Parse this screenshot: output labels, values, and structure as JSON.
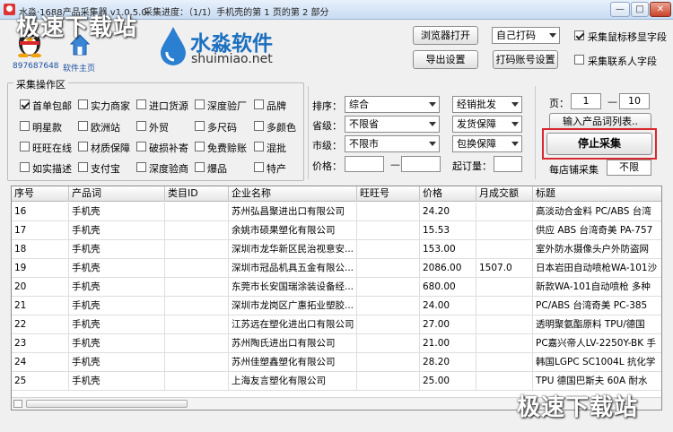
{
  "window": {
    "title": "水淼·1688产品采集器 v1.0.5.0",
    "progress": "采集进度：（1/1）手机壳的第 1 页的第 2 部分",
    "min": "—",
    "max": "□",
    "close": "✕"
  },
  "watermark": "极速下载站",
  "header": {
    "qq_number": "897687648",
    "home_link": "软件主页",
    "logo_cn": "水淼软件",
    "logo_en": "shuimiao.net",
    "browser_button": "浏览器打开",
    "print_select": "自己打码",
    "export_button": "导出设置",
    "print_settings_button": "打码账号设置",
    "cb_mark_fields": {
      "label": "采集鼠标移显字段",
      "checked": true
    },
    "cb_contact_fields": {
      "label": "采集联系人字段",
      "checked": false
    }
  },
  "filters": {
    "title": "采集操作区",
    "checkboxes": [
      {
        "label": "首单包邮",
        "checked": true
      },
      {
        "label": "实力商家",
        "checked": false
      },
      {
        "label": "进口货源",
        "checked": false
      },
      {
        "label": "深度验厂",
        "checked": false
      },
      {
        "label": "品牌",
        "checked": false
      },
      {
        "label": "明星款",
        "checked": false
      },
      {
        "label": "欧洲站",
        "checked": false
      },
      {
        "label": "外贸",
        "checked": false
      },
      {
        "label": "多尺码",
        "checked": false
      },
      {
        "label": "多颜色",
        "checked": false
      },
      {
        "label": "旺旺在线",
        "checked": false
      },
      {
        "label": "材质保障",
        "checked": false
      },
      {
        "label": "破损补寄",
        "checked": false
      },
      {
        "label": "免费赊账",
        "checked": false
      },
      {
        "label": "混批",
        "checked": false
      },
      {
        "label": "如实描述",
        "checked": false
      },
      {
        "label": "支付宝",
        "checked": false
      },
      {
        "label": "深度验商",
        "checked": false
      },
      {
        "label": "爆品",
        "checked": false
      },
      {
        "label": "特产",
        "checked": false
      }
    ]
  },
  "search": {
    "sort_label": "排序：",
    "sort_value": "综合",
    "province_label": "省级：",
    "province_value": "不限省",
    "city_label": "市级：",
    "city_value": "不限市",
    "price_label": "价格：",
    "price_min": "",
    "price_sep": "—",
    "price_max": "",
    "sell_mode": "经销批发",
    "ship_guarantee": "发货保障",
    "exchange_guarantee": "包换保障",
    "min_order_label": "起订量：",
    "min_order_value": ""
  },
  "collect": {
    "page_label": "页：",
    "page_from": "1",
    "page_sep": "—",
    "page_to": "10",
    "import_button": "输入产品词列表..",
    "stop_button": "停止采集",
    "per_shop_label": "每店铺采集",
    "per_shop_value": "不限"
  },
  "table": {
    "columns": [
      "序号",
      "产品词",
      "类目ID",
      "企业名称",
      "旺旺号",
      "价格",
      "月成交额",
      "标题"
    ],
    "rows": [
      [
        "16",
        "手机壳",
        "",
        "苏州弘昌聚进出口有限公司",
        "",
        "24.20",
        "",
        "高淡动合金料 PC/ABS 台湾"
      ],
      [
        "17",
        "手机壳",
        "",
        "余姚市硕果塑化有限公司",
        "",
        "15.53",
        "",
        "供应 ABS 台湾奇美 PA-757"
      ],
      [
        "18",
        "手机壳",
        "",
        "深圳市龙华新区民治视意安...",
        "",
        "153.00",
        "",
        "室外防水摄像头户外防盗网"
      ],
      [
        "19",
        "手机壳",
        "",
        "深圳市冠品机具五金有限公...",
        "",
        "2086.00",
        "1507.0",
        "日本岩田自动喷枪WA-101沙"
      ],
      [
        "20",
        "手机壳",
        "",
        "东莞市长安国瑞涂装设备经...",
        "",
        "680.00",
        "",
        "新款WA-101自动喷枪 多种"
      ],
      [
        "21",
        "手机壳",
        "",
        "深圳市龙岗区广惠拓业塑胶...",
        "",
        "24.00",
        "",
        "PC/ABS 台湾奇美 PC-385"
      ],
      [
        "22",
        "手机壳",
        "",
        "江苏远在塑化进出口有限公司",
        "",
        "27.00",
        "",
        "透明聚氨酯原料 TPU/德国"
      ],
      [
        "23",
        "手机壳",
        "",
        "苏州陶氏进出口有限公司",
        "",
        "21.00",
        "",
        "PC嘉兴帝人LV-2250Y-BK 手"
      ],
      [
        "24",
        "手机壳",
        "",
        "苏州佳塑鑫塑化有限公司",
        "",
        "28.20",
        "",
        "韩国LGPC SC1004L 抗化学"
      ],
      [
        "25",
        "手机壳",
        "",
        "上海友言塑化有限公司",
        "",
        "25.00",
        "",
        "TPU 德国巴斯夫 60A 耐水"
      ]
    ]
  }
}
